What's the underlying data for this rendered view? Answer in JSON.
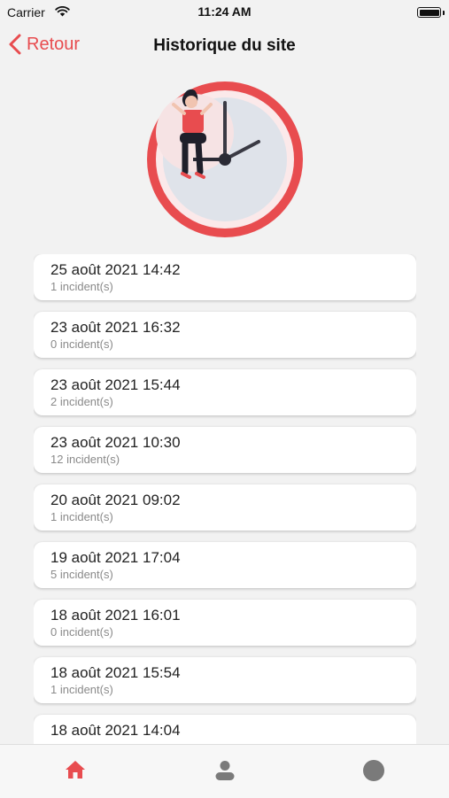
{
  "status_bar": {
    "carrier": "Carrier",
    "time": "11:24 AM"
  },
  "nav": {
    "back_label": "Retour",
    "title": "Historique du site"
  },
  "colors": {
    "accent": "#e84c4f",
    "inactive_icon": "#7a7a7a",
    "card_bg": "#ffffff",
    "page_bg": "#f2f2f2"
  },
  "history": [
    {
      "date": "25 août 2021 14:42",
      "incidents": "1 incident(s)"
    },
    {
      "date": "23 août 2021 16:32",
      "incidents": "0 incident(s)"
    },
    {
      "date": "23 août 2021 15:44",
      "incidents": "2 incident(s)"
    },
    {
      "date": "23 août 2021 10:30",
      "incidents": "12 incident(s)"
    },
    {
      "date": "20 août 2021 09:02",
      "incidents": "1 incident(s)"
    },
    {
      "date": "19 août 2021 17:04",
      "incidents": "5 incident(s)"
    },
    {
      "date": "18 août 2021 16:01",
      "incidents": "0 incident(s)"
    },
    {
      "date": "18 août 2021 15:54",
      "incidents": "1 incident(s)"
    },
    {
      "date": "18 août 2021 14:04",
      "incidents": ""
    }
  ],
  "tabs": [
    {
      "icon": "home-icon",
      "active": true
    },
    {
      "icon": "person-icon",
      "active": false
    },
    {
      "icon": "circle-icon",
      "active": false
    }
  ]
}
